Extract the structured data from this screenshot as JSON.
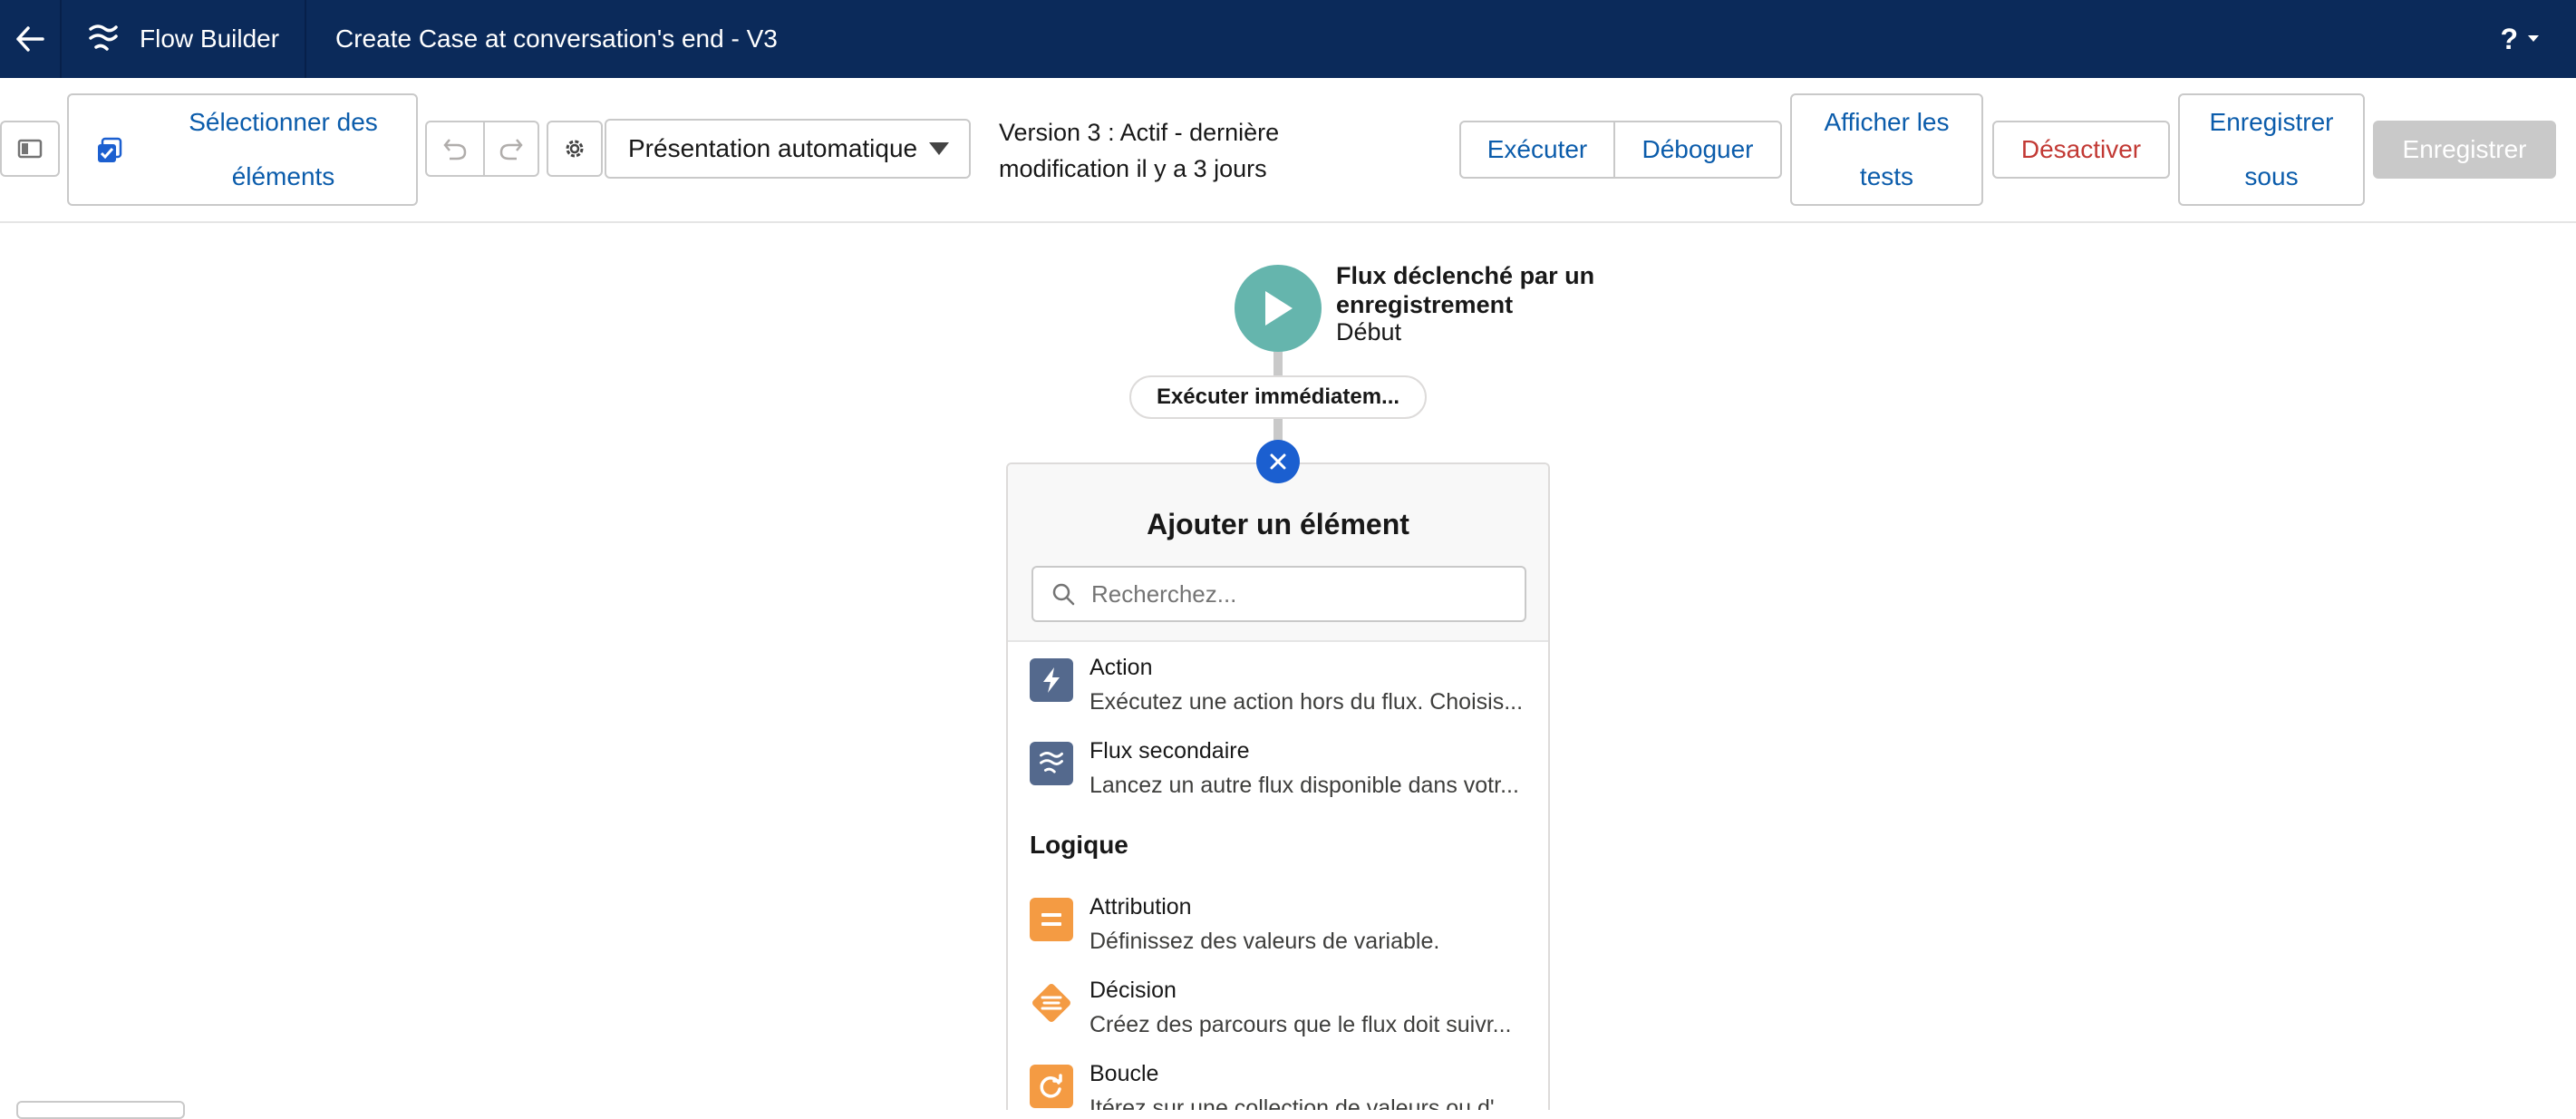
{
  "header": {
    "app_name": "Flow Builder",
    "flow_title": "Create Case at conversation's end - V3",
    "help_label": "?"
  },
  "toolbar": {
    "select_elements_label": "Sélectionner des éléments",
    "layout_value": "Présentation automatique",
    "version_text": "Version 3 : Actif - dernière modification il y a 3 jours",
    "run_label": "Exécuter",
    "debug_label": "Déboguer",
    "view_tests_label": "Afficher les tests",
    "deactivate_label": "Désactiver",
    "save_as_label": "Enregistrer sous",
    "save_label": "Enregistrer"
  },
  "canvas": {
    "start_title": "Flux déclenché par un enregistrement",
    "start_subtitle": "Début",
    "run_path_label": "Exécuter immédiatem..."
  },
  "panel": {
    "title": "Ajouter un élément",
    "search_placeholder": "Recherchez...",
    "items": [
      {
        "name": "Action",
        "desc": "Exécutez une action hors du flux. Choisis..."
      },
      {
        "name": "Flux secondaire",
        "desc": "Lancez un autre flux disponible dans votr..."
      }
    ],
    "logic_section": "Logique",
    "logic_items": [
      {
        "name": "Attribution",
        "desc": "Définissez des valeurs de variable."
      },
      {
        "name": "Décision",
        "desc": "Créez des parcours que le flux doit suivr..."
      },
      {
        "name": "Boucle",
        "desc": "Itérez sur une collection de valeurs ou d'..."
      }
    ]
  },
  "colors": {
    "header_bg": "#0b2a5a",
    "brand_blue": "#0b5cab",
    "start_teal": "#65b5ad",
    "action_slate": "#54698d",
    "logic_orange": "#f49b43",
    "deactivate_red": "#c23934"
  }
}
